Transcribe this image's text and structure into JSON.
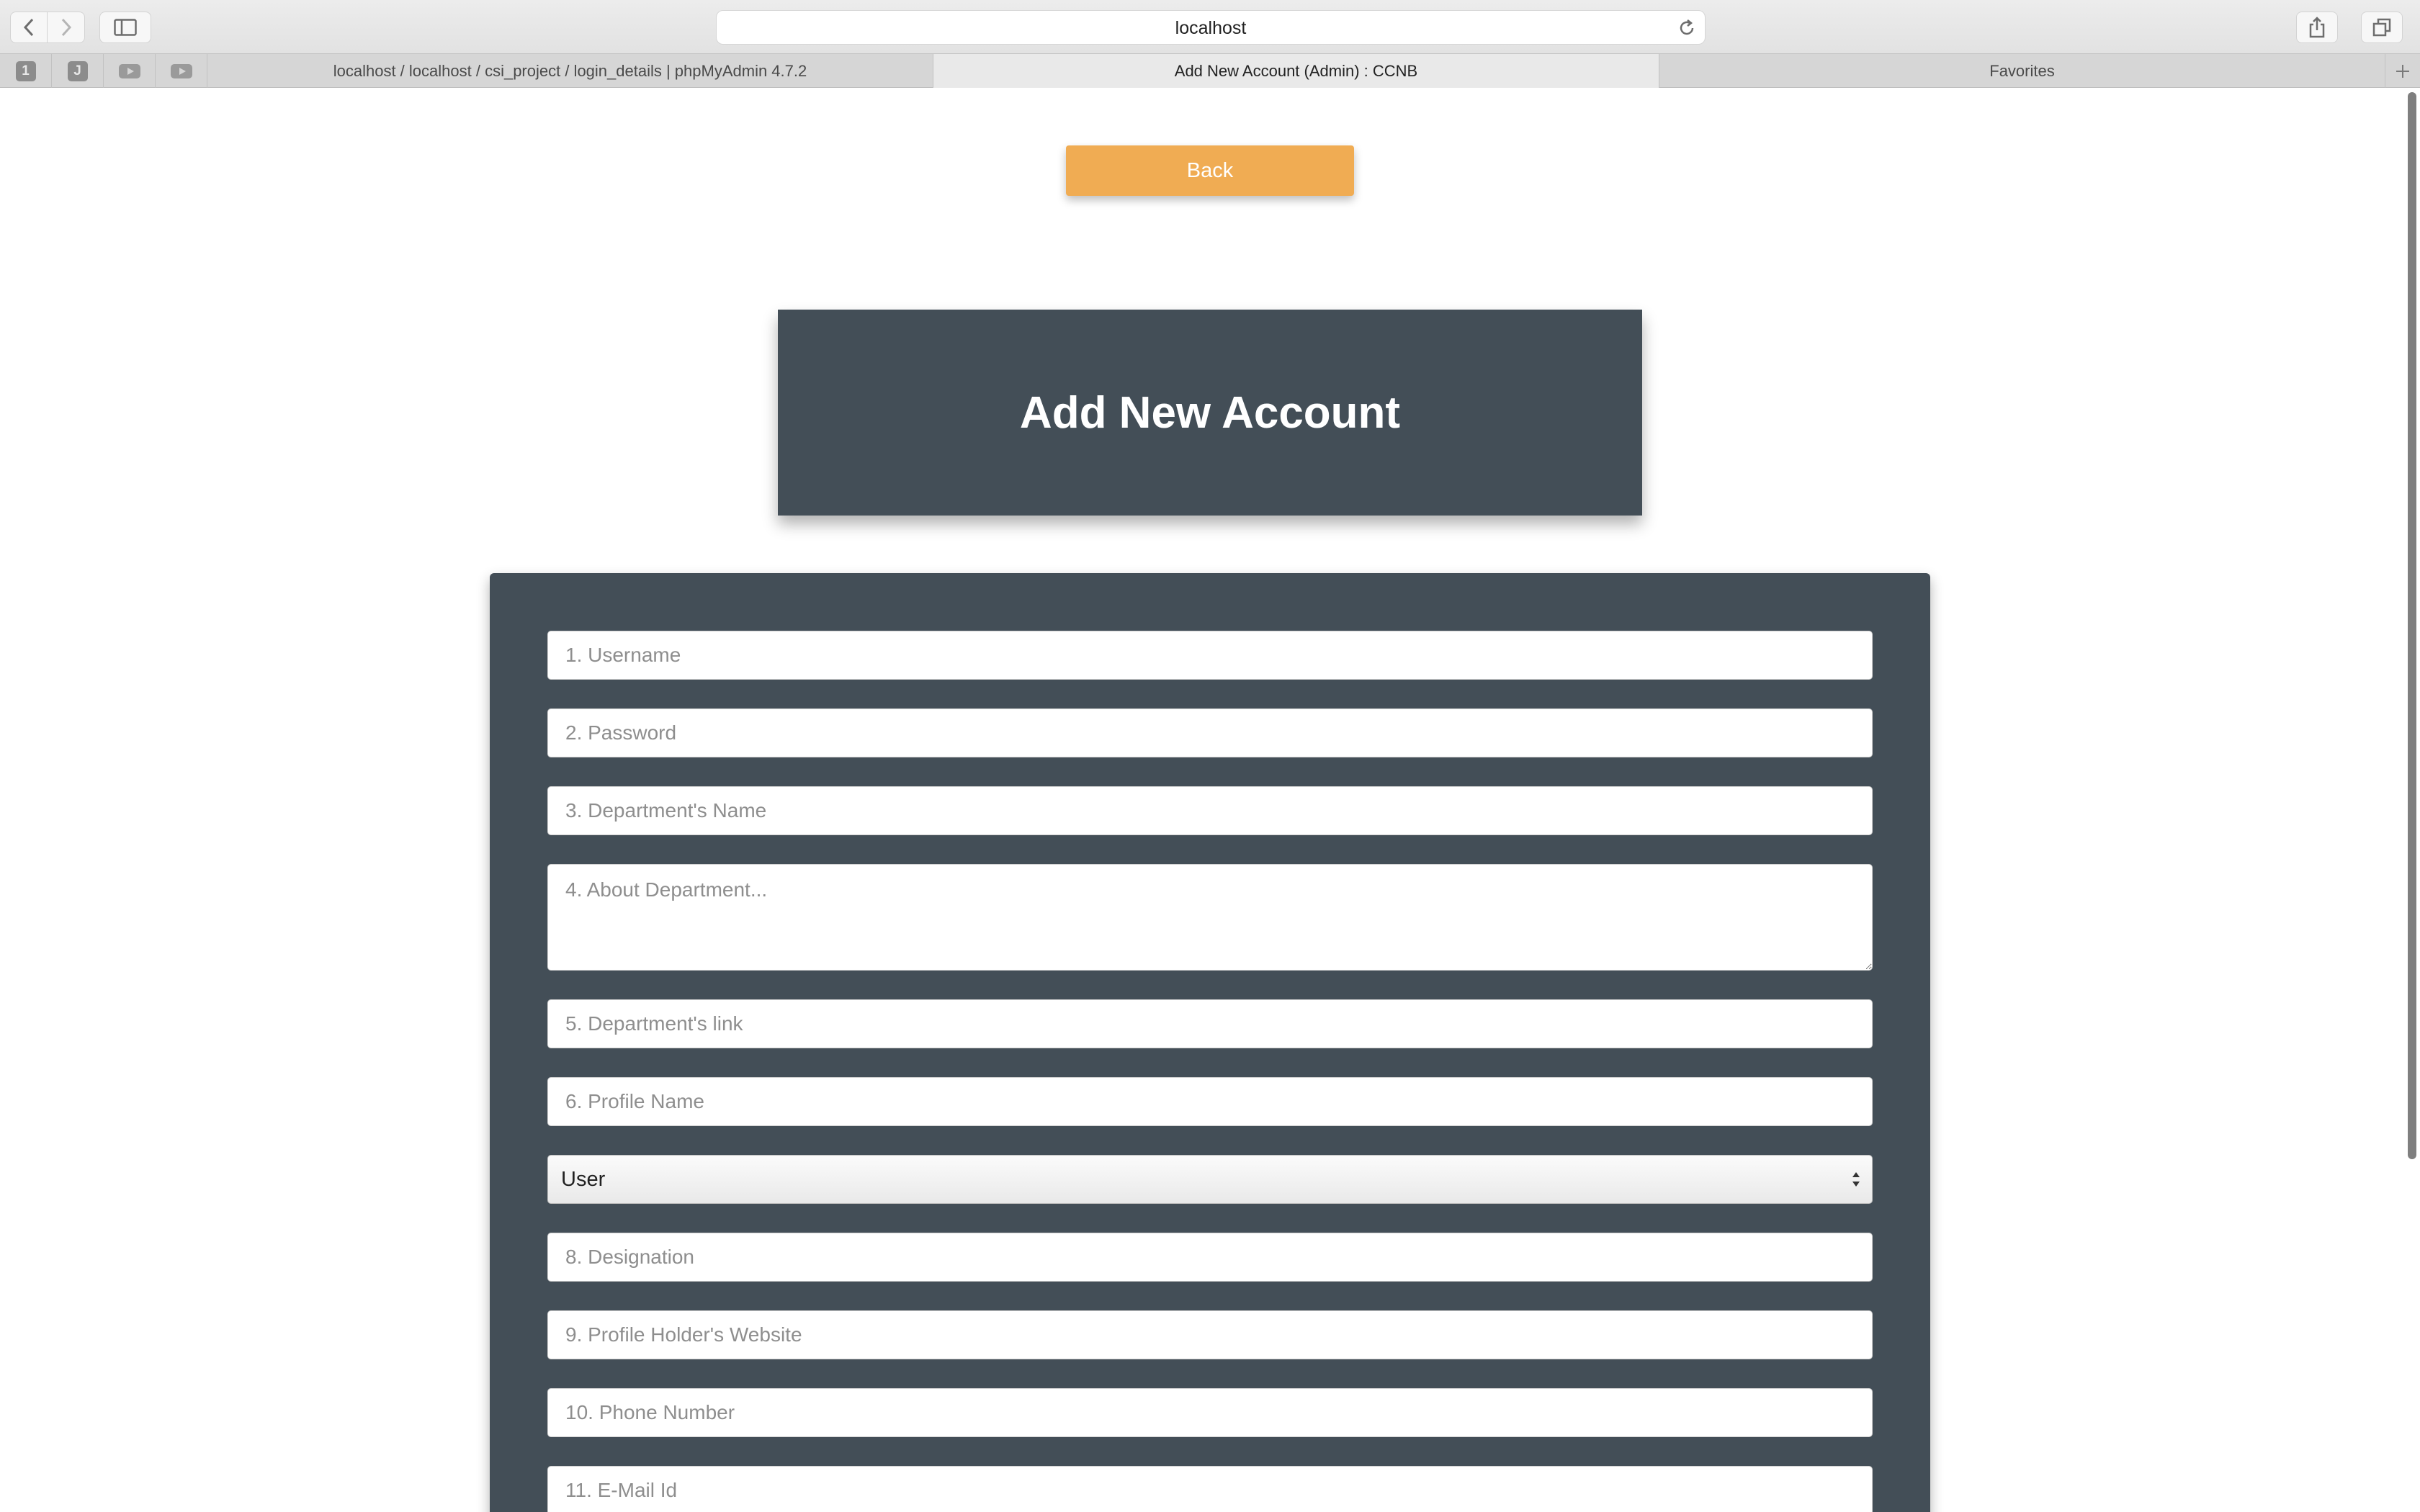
{
  "browser": {
    "address": "localhost",
    "tabs": [
      {
        "title": "localhost / localhost / csi_project / login_details | phpMyAdmin 4.7.2"
      },
      {
        "title": "Add New Account (Admin) : CCNB"
      },
      {
        "title": "Favorites"
      }
    ],
    "pinned": [
      {
        "label": "1"
      },
      {
        "label": "J"
      }
    ]
  },
  "page": {
    "back_label": "Back",
    "heading": "Add New Account",
    "form": {
      "username_placeholder": "1. Username",
      "password_placeholder": "2. Password",
      "dept_name_placeholder": "3. Department's Name",
      "about_placeholder": "4. About Department...",
      "dept_link_placeholder": "5. Department's link",
      "profile_name_placeholder": "6. Profile Name",
      "role_value": "User",
      "designation_placeholder": "8. Designation",
      "website_placeholder": "9. Profile Holder's Website",
      "phone_placeholder": "10. Phone Number",
      "email_placeholder": "11. E-Mail Id"
    }
  },
  "colors": {
    "back_button": "#f0ac53",
    "panel": "#434e57"
  }
}
